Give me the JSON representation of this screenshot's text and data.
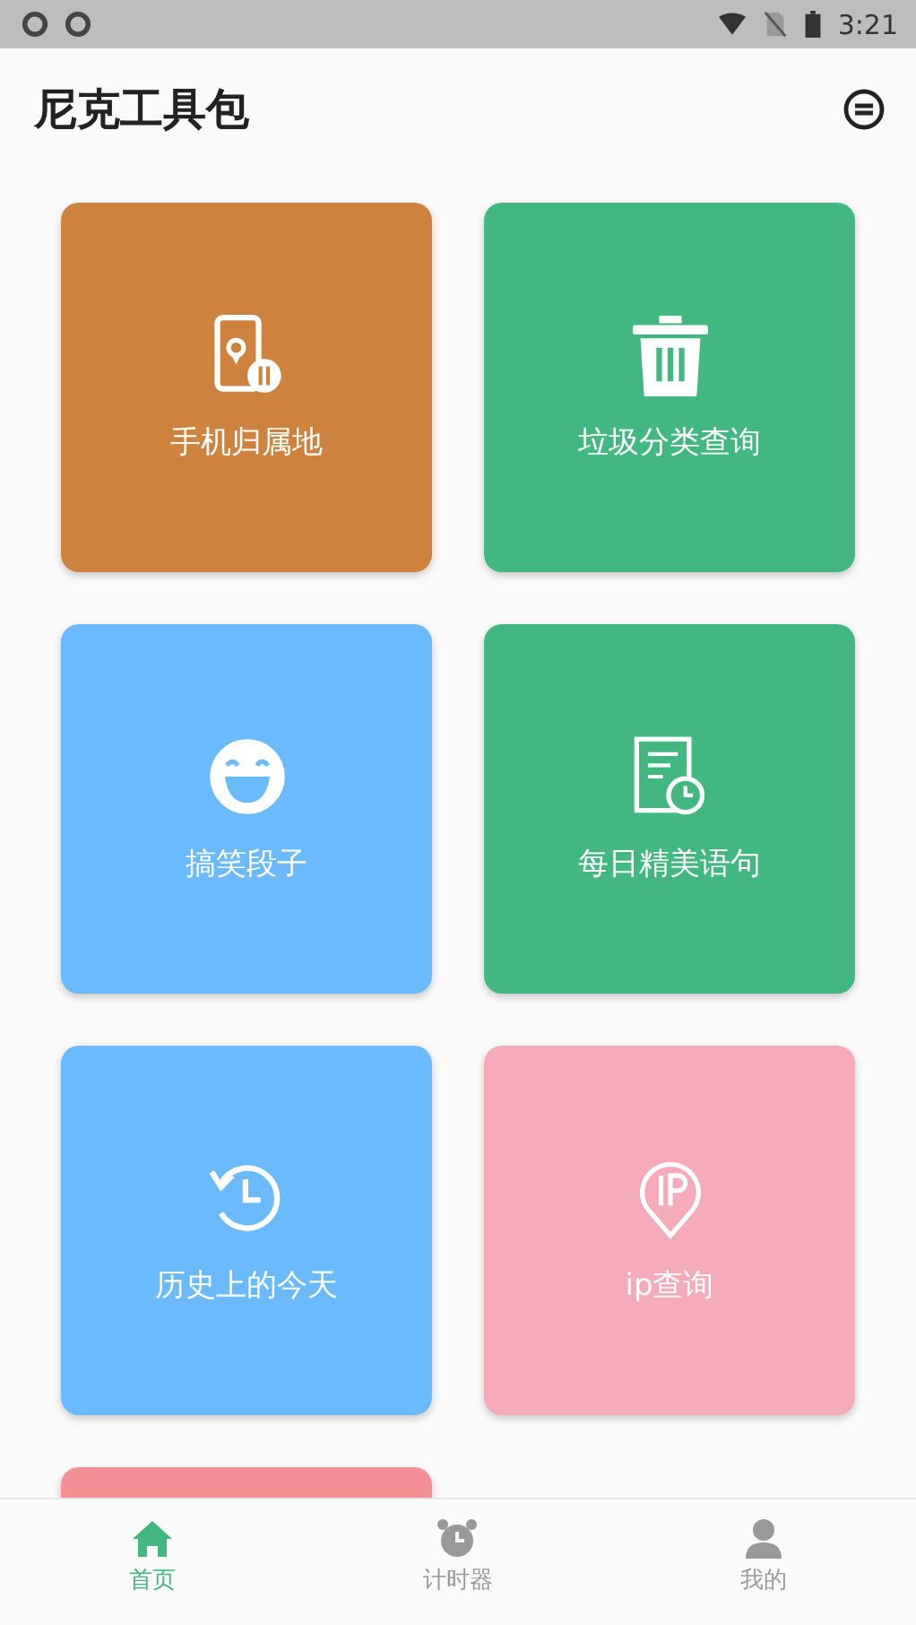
{
  "status_bar": {
    "time": "3:21"
  },
  "app_bar": {
    "title": "尼克工具包"
  },
  "tiles": [
    {
      "label": "手机归属地",
      "color": "#cd833e",
      "kind": "phone"
    },
    {
      "label": "垃圾分类查询",
      "color": "#42b880",
      "kind": "trash"
    },
    {
      "label": "搞笑段子",
      "color": "#6cbafe",
      "kind": "laugh"
    },
    {
      "label": "每日精美语句",
      "color": "#42b880",
      "kind": "doc"
    },
    {
      "label": "历史上的今天",
      "color": "#6cbafe",
      "kind": "history"
    },
    {
      "label": "ip查询",
      "color": "#f5aaba",
      "kind": "ip"
    },
    {
      "color": "#f48f96",
      "kind": "none"
    }
  ],
  "bottom_nav": [
    {
      "label": "首页",
      "kind": "home",
      "selected": true
    },
    {
      "label": "计时器",
      "kind": "alarm",
      "selected": false
    },
    {
      "label": "我的",
      "kind": "person",
      "selected": false
    }
  ]
}
